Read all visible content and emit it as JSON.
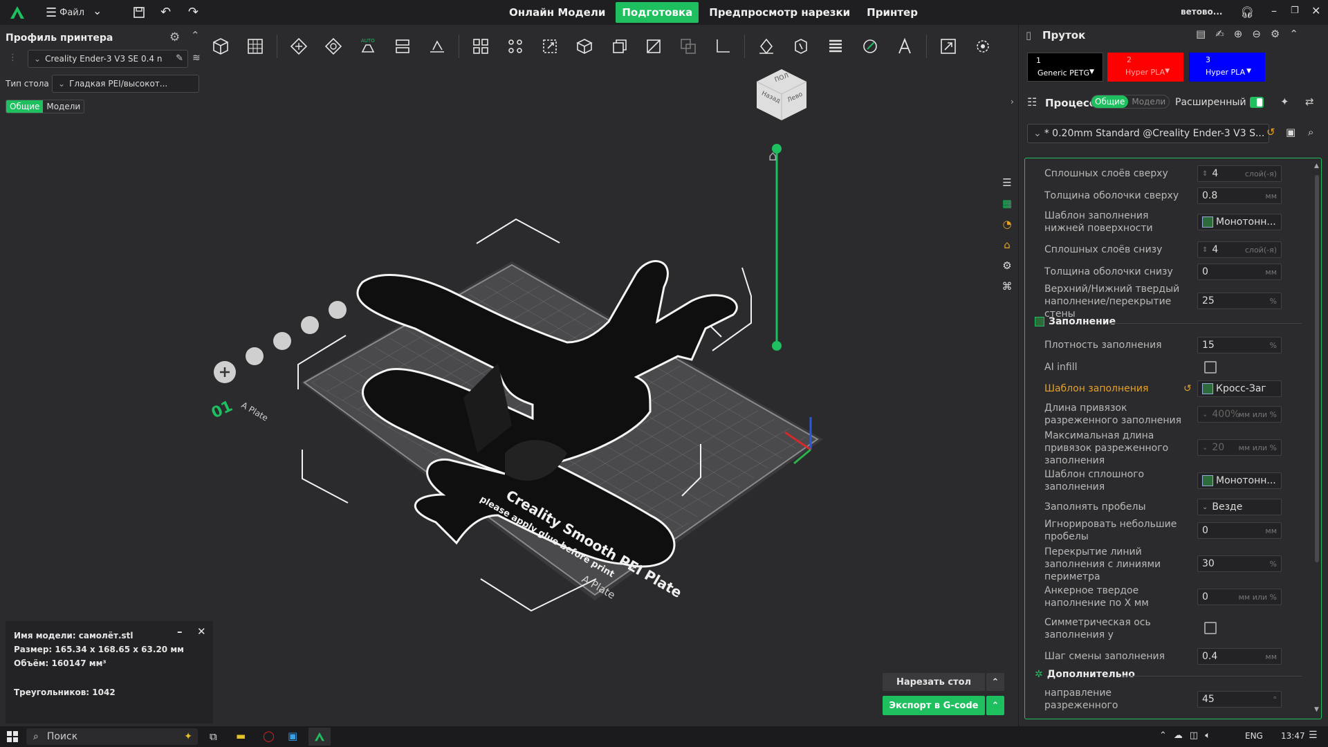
{
  "titlebar": {
    "menu_label": "Файл",
    "tabs": [
      "Онлайн Модели",
      "Подготовка",
      "Предпросмотр нарезки",
      "Принтер"
    ],
    "active_tab": "Подготовка",
    "user": "ветово..."
  },
  "left_panel": {
    "title": "Профиль принтера",
    "printer": "Creality Ender-3 V3 SE 0.4 n",
    "bed_label": "Тип стола",
    "bed_value": "Гладкая PEI/высокот...",
    "toggle": [
      "Общие",
      "Модели"
    ]
  },
  "filament": {
    "title": "Пруток",
    "slots": [
      {
        "num": "1",
        "name": "Generic PETG",
        "color": "#000000"
      },
      {
        "num": "2",
        "name": "Hyper PLA",
        "color": "#ff0000"
      },
      {
        "num": "3",
        "name": "Hyper PLA",
        "color": "#0000ff"
      }
    ]
  },
  "process": {
    "title": "Процесс",
    "toggle": [
      "Общие",
      "Модели"
    ],
    "advanced_label": "Расширенный",
    "preset": "* 0.20mm Standard @Creality Ender-3 V3 S..."
  },
  "settings": {
    "rows": [
      {
        "label": "Сплошных слоёв сверху",
        "value": "4",
        "unit": "слой(-я)",
        "spin": true
      },
      {
        "label": "Толщина оболочки сверху",
        "value": "0.8",
        "unit": "мм"
      },
      {
        "label": "Шаблон заполнения нижней поверхности",
        "value": "Монотонн...",
        "pattern": true
      },
      {
        "label": "Сплошных слоёв снизу",
        "value": "4",
        "unit": "слой(-я)",
        "spin": true
      },
      {
        "label": "Толщина оболочки снизу",
        "value": "0",
        "unit": "мм"
      },
      {
        "label": "Верхний/Нижний твердый наполнение/перекрытие стены",
        "value": "25",
        "unit": "%"
      }
    ],
    "infill_section": "Заполнение",
    "infill_rows": [
      {
        "label": "Плотность заполнения",
        "value": "15",
        "unit": "%"
      },
      {
        "label": "AI infill",
        "checkbox": true
      },
      {
        "label": "Шаблон заполнения",
        "value": "Кросс-Заг",
        "pattern": true,
        "highlight": true
      },
      {
        "label": "Длина привязок разреженного заполнения",
        "value": "400%",
        "unit": "мм или %",
        "disabled": true
      },
      {
        "label": "Максимальная длина привязок разреженного заполнения",
        "value": "20",
        "unit": "мм или %",
        "disabled": true
      },
      {
        "label": "Шаблон сплошного заполнения",
        "value": "Монотонн...",
        "pattern": true
      },
      {
        "label": "Заполнять пробелы",
        "value": "Везде",
        "select": true
      },
      {
        "label": "Игнорировать небольшие пробелы",
        "value": "0",
        "unit": "мм"
      },
      {
        "label": "Перекрытие линий заполнения с линиями периметра",
        "value": "30",
        "unit": "%"
      },
      {
        "label": "Анкерное твердое наполнение по X мм",
        "value": "0",
        "unit": "мм или %"
      },
      {
        "label": "Симметрическая ось заполнения y",
        "checkbox": true
      },
      {
        "label": "Шаг смены заполнения",
        "value": "0.4",
        "unit": "мм"
      }
    ],
    "extra_section": "Дополнительно",
    "extra_rows": [
      {
        "label": "направление разреженного",
        "value": "45",
        "unit": "°"
      }
    ]
  },
  "model_info": {
    "name": "Имя модели: самолёт.stl",
    "size": "Размер: 165.34 x 168.65 x 63.20 мм",
    "volume": "Объём: 160147 мм³",
    "triangles": "Треугольников: 1042"
  },
  "actions": {
    "slice": "Нарезать стол",
    "export": "Экспорт в G-code"
  },
  "plate": {
    "number": "01",
    "label_a": "A Plate",
    "label_b": "A Plate",
    "text1": "Creality Smooth PEI Plate",
    "text2": "please apply glue before print"
  },
  "viewcube": {
    "top": "ПОЛ",
    "left": "Назад",
    "right": "Лево"
  },
  "taskbar": {
    "search": "Поиск",
    "lang": "ENG",
    "time": "13:47"
  },
  "colors": {
    "accent": "#1dbf5f",
    "highlight": "#e5a227"
  }
}
